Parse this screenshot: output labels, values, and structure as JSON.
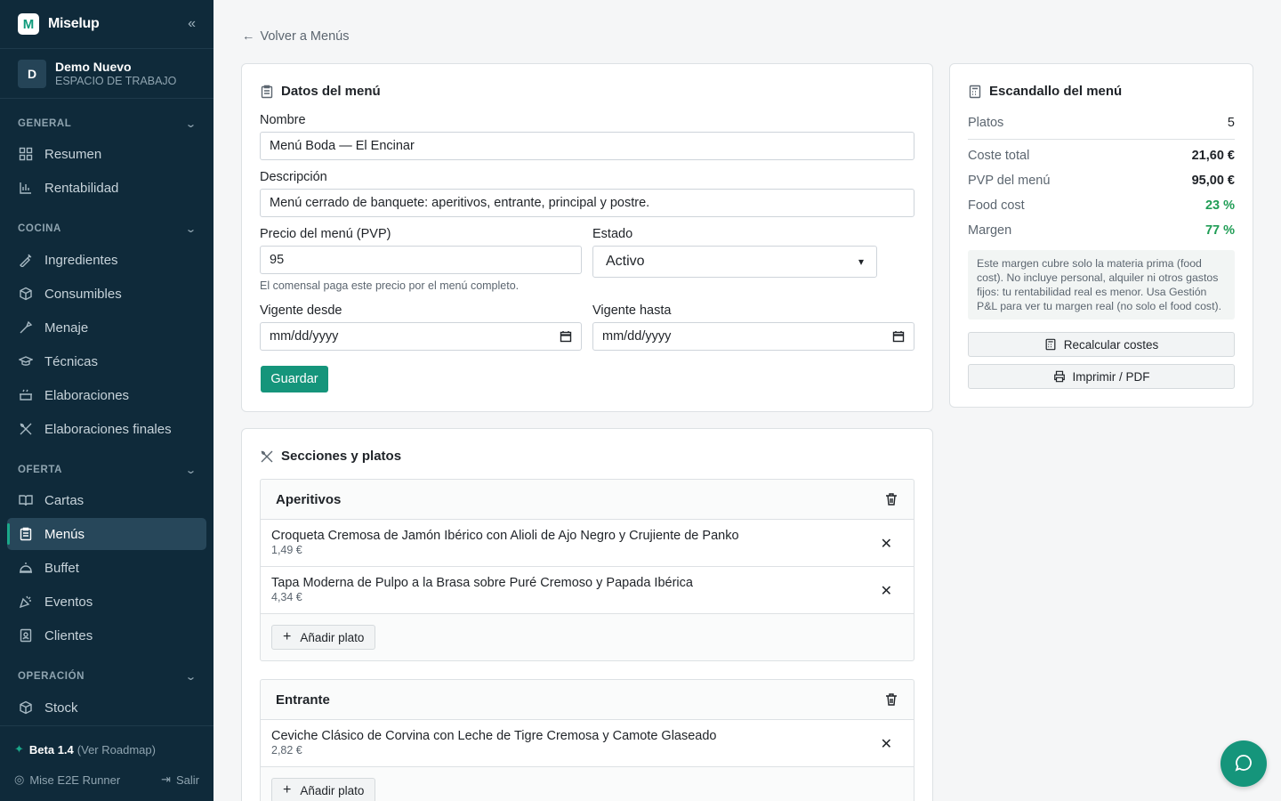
{
  "brand": {
    "name": "Miselup",
    "logo_letter": "M"
  },
  "workspace": {
    "initial": "D",
    "name": "Demo Nuevo",
    "subtitle": "ESPACIO DE TRABAJO"
  },
  "sidebar": {
    "sections": [
      {
        "label": "GENERAL"
      },
      {
        "label": "COCINA"
      },
      {
        "label": "OFERTA"
      },
      {
        "label": "OPERACIÓN"
      }
    ],
    "items": [
      {
        "label": "Resumen",
        "icon": "grid-icon"
      },
      {
        "label": "Rentabilidad",
        "icon": "bar-chart-icon"
      },
      {
        "label": "Ingredientes",
        "icon": "carrot-icon"
      },
      {
        "label": "Consumibles",
        "icon": "box-icon"
      },
      {
        "label": "Menaje",
        "icon": "tools-icon"
      },
      {
        "label": "Técnicas",
        "icon": "graduation-cap-icon"
      },
      {
        "label": "Elaboraciones",
        "icon": "pot-icon"
      },
      {
        "label": "Elaboraciones finales",
        "icon": "utensils-icon"
      },
      {
        "label": "Cartas",
        "icon": "book-open-icon"
      },
      {
        "label": "Menús",
        "icon": "clipboard-icon",
        "active": true
      },
      {
        "label": "Buffet",
        "icon": "cloche-icon"
      },
      {
        "label": "Eventos",
        "icon": "party-icon"
      },
      {
        "label": "Clientes",
        "icon": "contact-icon"
      },
      {
        "label": "Stock",
        "icon": "package-icon"
      }
    ],
    "footer": {
      "beta_label": "Beta 1.4",
      "roadmap_label": "(Ver Roadmap)",
      "user_label": "Mise E2E Runner",
      "logout_label": "Salir"
    }
  },
  "back_link": "Volver a Menús",
  "menu_form": {
    "title": "Datos del menú",
    "name_label": "Nombre",
    "name_value": "Menú Boda — El Encinar",
    "description_label": "Descripción",
    "description_value": "Menú cerrado de banquete: aperitivos, entrante, principal y postre.",
    "price_label": "Precio del menú (PVP)",
    "price_value": "95",
    "price_hint": "El comensal paga este precio por el menú completo.",
    "status_label": "Estado",
    "status_value": "Activo",
    "valid_from_label": "Vigente desde",
    "valid_from_value": "mm/dd/yyyy",
    "valid_to_label": "Vigente hasta",
    "valid_to_value": "mm/dd/yyyy",
    "save_label": "Guardar"
  },
  "costing": {
    "title": "Escandallo del menú",
    "dishes_label": "Platos",
    "dishes_value": "5",
    "total_cost_label": "Coste total",
    "total_cost_value": "21,60 €",
    "pvp_label": "PVP del menú",
    "pvp_value": "95,00 €",
    "food_cost_label": "Food cost",
    "food_cost_value": "23 %",
    "margin_label": "Margen",
    "margin_value": "77 %",
    "note": "Este margen cubre solo la materia prima (food cost). No incluye personal, alquiler ni otros gastos fijos: tu rentabilidad real es menor. Usa Gestión P&L para ver tu margen real (no solo el food cost).",
    "recalc_label": "Recalcular costes",
    "print_label": "Imprimir / PDF"
  },
  "sections_card": {
    "title": "Secciones y platos",
    "add_dish_label": "Añadir plato",
    "sections": [
      {
        "name": "Aperitivos",
        "dishes": [
          {
            "name": "Croqueta Cremosa de Jamón Ibérico con Alioli de Ajo Negro y Crujiente de Panko",
            "price": "1,49 €"
          },
          {
            "name": "Tapa Moderna de Pulpo a la Brasa sobre Puré Cremoso y Papada Ibérica",
            "price": "4,34 €"
          }
        ]
      },
      {
        "name": "Entrante",
        "dishes": [
          {
            "name": "Ceviche Clásico de Corvina con Leche de Tigre Cremosa y Camote Glaseado",
            "price": "2,82 €"
          }
        ]
      }
    ]
  },
  "colors": {
    "sidebar_bg": "#0f2a3a",
    "accent": "#15957b",
    "positive": "#1f9d55"
  }
}
